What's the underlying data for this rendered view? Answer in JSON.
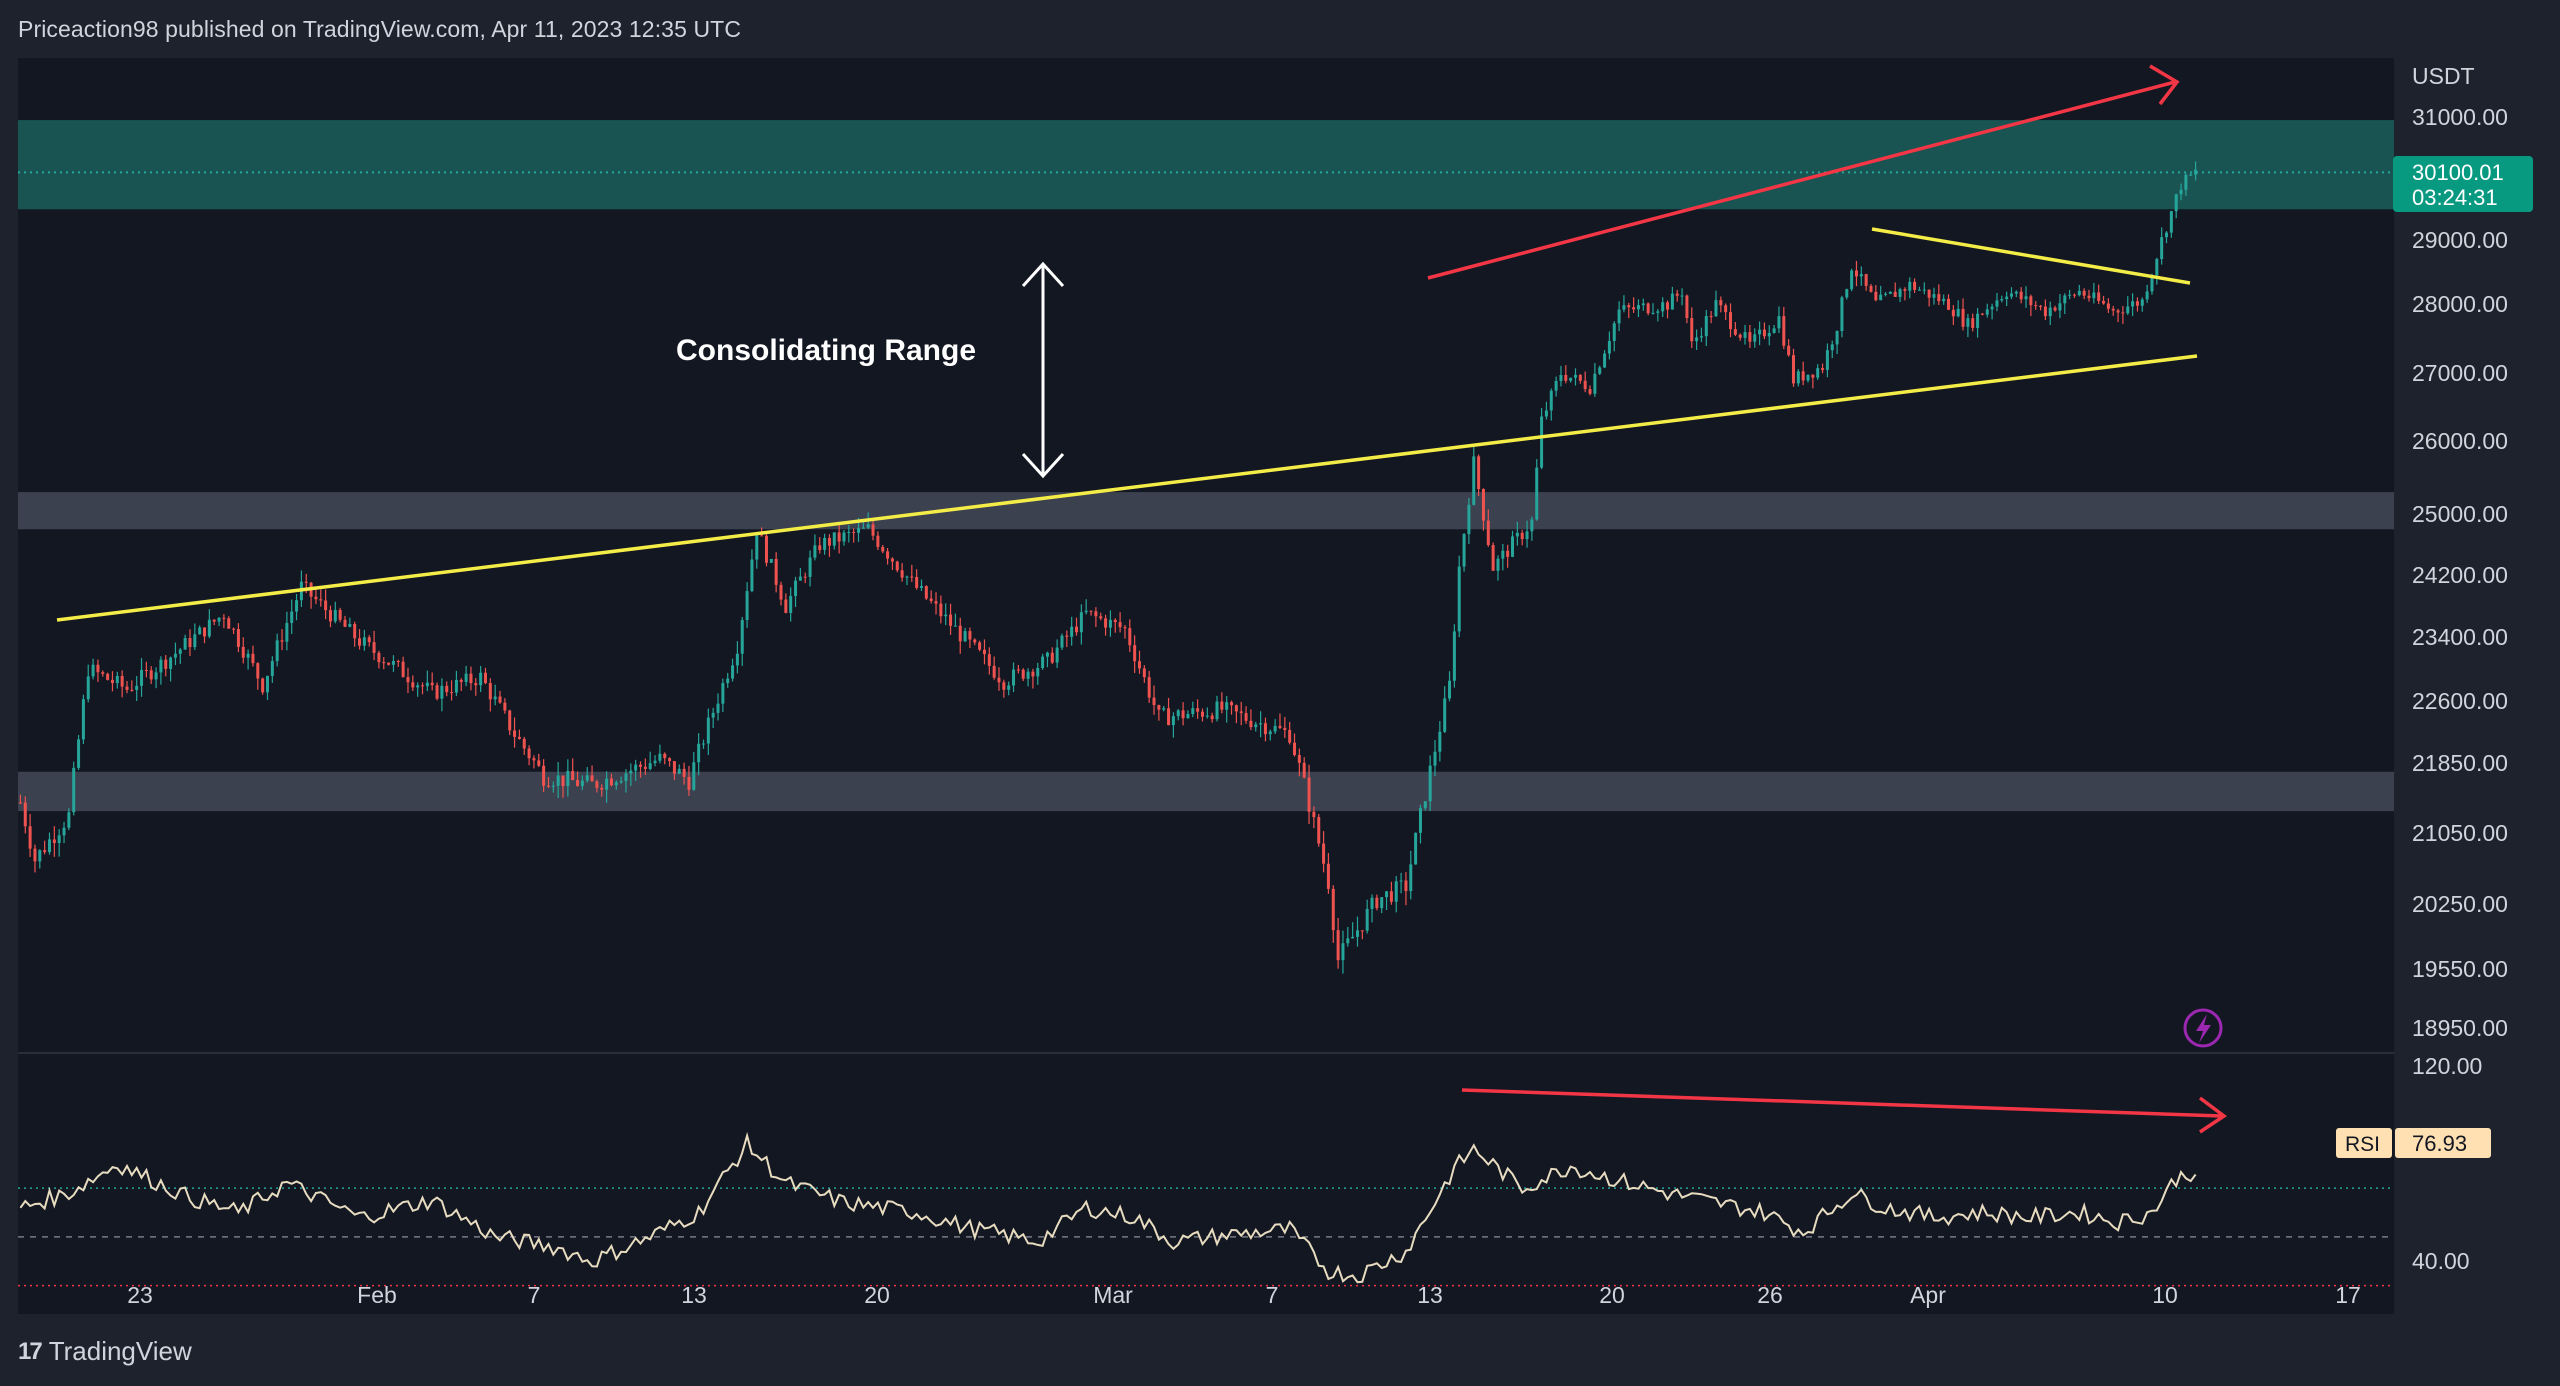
{
  "header": {
    "published_by": "Priceaction98 published on TradingView.com, Apr 11, 2023 12:35 UTC"
  },
  "footer": {
    "brand": "TradingView",
    "logo": "17"
  },
  "colors": {
    "background": "#1e222d",
    "plot_background": "#131722",
    "up_candle": "#26a69a",
    "down_candle": "#ef5350",
    "resistance_zone": "#1b5e5a",
    "range_zone": "#434957",
    "trendline": "#f4ec47",
    "arrow_red": "#f23645",
    "rsi_line": "#e8dcc0",
    "price_badge": "#089981"
  },
  "chart_data": [
    {
      "type": "candlestick",
      "symbol_unit": "USDT",
      "ylim": [
        18700,
        31800
      ],
      "x_ticks": [
        "23",
        "Feb",
        "7",
        "13",
        "20",
        "Mar",
        "7",
        "13",
        "20",
        "26",
        "Apr",
        "10",
        "17"
      ],
      "y_ticks": [
        "31000.00",
        "29000.00",
        "28000.00",
        "27000.00",
        "26000.00",
        "25000.00",
        "24200.00",
        "23400.00",
        "22600.00",
        "21850.00",
        "21050.00",
        "20250.00",
        "19550.00",
        "18950.00"
      ],
      "last_price": "30100.01",
      "countdown": "03:24:31",
      "annotation": "Consolidating Range",
      "zones": [
        {
          "name": "resistance",
          "from": 29500,
          "to": 30950
        },
        {
          "name": "upper-range",
          "from": 24800,
          "to": 25300
        },
        {
          "name": "lower-range",
          "from": 21300,
          "to": 21750
        }
      ],
      "series_path": [
        [
          0,
          21400
        ],
        [
          3,
          20750
        ],
        [
          10,
          21250
        ],
        [
          14,
          23000
        ],
        [
          22,
          22750
        ],
        [
          32,
          23200
        ],
        [
          42,
          23700
        ],
        [
          50,
          22800
        ],
        [
          58,
          24050
        ],
        [
          70,
          23350
        ],
        [
          85,
          22700
        ],
        [
          95,
          22900
        ],
        [
          102,
          22200
        ],
        [
          108,
          21700
        ],
        [
          118,
          21600
        ],
        [
          132,
          21900
        ],
        [
          138,
          21650
        ],
        [
          148,
          23300
        ],
        [
          152,
          24800
        ],
        [
          158,
          23800
        ],
        [
          165,
          24600
        ],
        [
          175,
          24800
        ],
        [
          184,
          24100
        ],
        [
          193,
          23500
        ],
        [
          203,
          22850
        ],
        [
          212,
          23100
        ],
        [
          220,
          23700
        ],
        [
          228,
          23500
        ],
        [
          235,
          22400
        ],
        [
          248,
          22500
        ],
        [
          262,
          22200
        ],
        [
          265,
          21600
        ],
        [
          270,
          20500
        ],
        [
          272,
          19650
        ],
        [
          280,
          20300
        ],
        [
          286,
          20450
        ],
        [
          290,
          21500
        ],
        [
          295,
          22800
        ],
        [
          297,
          24300
        ],
        [
          300,
          25700
        ],
        [
          304,
          24300
        ],
        [
          308,
          24600
        ],
        [
          312,
          24900
        ],
        [
          314,
          26300
        ],
        [
          318,
          27000
        ],
        [
          324,
          26800
        ],
        [
          330,
          27900
        ],
        [
          340,
          28000
        ],
        [
          343,
          28200
        ],
        [
          345,
          27400
        ],
        [
          350,
          28000
        ],
        [
          357,
          27400
        ],
        [
          363,
          27800
        ],
        [
          366,
          26900
        ],
        [
          372,
          27100
        ],
        [
          375,
          27700
        ],
        [
          378,
          28600
        ],
        [
          383,
          28000
        ],
        [
          390,
          28300
        ],
        [
          398,
          28000
        ],
        [
          402,
          27700
        ],
        [
          410,
          28200
        ],
        [
          418,
          27900
        ],
        [
          425,
          28200
        ],
        [
          432,
          27900
        ],
        [
          438,
          28050
        ],
        [
          442,
          29000
        ],
        [
          446,
          29900
        ],
        [
          449,
          30100
        ]
      ]
    },
    {
      "type": "line",
      "indicator": "RSI",
      "value": "76.93",
      "ylim": [
        20,
        125
      ],
      "y_ticks": [
        "120.00",
        "40.00"
      ],
      "levels": [
        70,
        50,
        30
      ],
      "series_path": [
        [
          0,
          62
        ],
        [
          10,
          68
        ],
        [
          20,
          80
        ],
        [
          35,
          66
        ],
        [
          45,
          60
        ],
        [
          55,
          72
        ],
        [
          70,
          58
        ],
        [
          85,
          65
        ],
        [
          98,
          50
        ],
        [
          110,
          46
        ],
        [
          118,
          40
        ],
        [
          130,
          50
        ],
        [
          140,
          60
        ],
        [
          150,
          88
        ],
        [
          158,
          72
        ],
        [
          170,
          64
        ],
        [
          185,
          60
        ],
        [
          195,
          54
        ],
        [
          210,
          48
        ],
        [
          220,
          62
        ],
        [
          230,
          58
        ],
        [
          238,
          48
        ],
        [
          250,
          51
        ],
        [
          262,
          53
        ],
        [
          270,
          36
        ],
        [
          276,
          34
        ],
        [
          286,
          44
        ],
        [
          296,
          78
        ],
        [
          300,
          86
        ],
        [
          310,
          70
        ],
        [
          320,
          79
        ],
        [
          330,
          73
        ],
        [
          340,
          68
        ],
        [
          350,
          64
        ],
        [
          360,
          60
        ],
        [
          368,
          52
        ],
        [
          378,
          68
        ],
        [
          385,
          62
        ],
        [
          395,
          58
        ],
        [
          405,
          60
        ],
        [
          415,
          58
        ],
        [
          425,
          60
        ],
        [
          433,
          56
        ],
        [
          440,
          60
        ],
        [
          445,
          74
        ],
        [
          449,
          77
        ]
      ]
    }
  ]
}
